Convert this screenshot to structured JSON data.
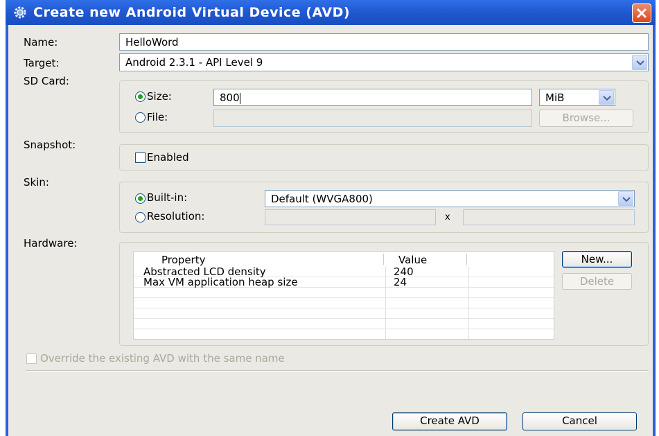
{
  "window": {
    "title": "Create new Android Virtual Device (AVD)",
    "title_icon": "gear-icon",
    "close_icon": "close-icon"
  },
  "form": {
    "name_label": "Name:",
    "name_value": "HelloWord",
    "target_label": "Target:",
    "target_value": "Android 2.3.1 - API Level 9",
    "sdcard_label": "SD Card:",
    "size_label": "Size:",
    "size_value": "800",
    "size_unit": "MiB",
    "file_label": "File:",
    "file_value": "",
    "browse_label": "Browse...",
    "snapshot_label": "Snapshot:",
    "enabled_label": "Enabled",
    "skin_label": "Skin:",
    "builtin_label": "Built-in:",
    "builtin_value": "Default (WVGA800)",
    "resolution_label": "Resolution:",
    "resolution_x": "x",
    "hardware_label": "Hardware:",
    "override_label": "Override the existing AVD with the same name"
  },
  "hardware_table": {
    "columns": [
      "Property",
      "Value"
    ],
    "rows": [
      {
        "property": "Abstracted LCD density",
        "value": "240"
      },
      {
        "property": "Max VM application heap size",
        "value": "24"
      }
    ],
    "new_label": "New...",
    "delete_label": "Delete"
  },
  "footer": {
    "create_label": "Create AVD",
    "cancel_label": "Cancel"
  },
  "colors": {
    "title_bar": "#1f56cf",
    "dialog_bg": "#ebe9e4",
    "radio_selected": "#21a121"
  }
}
